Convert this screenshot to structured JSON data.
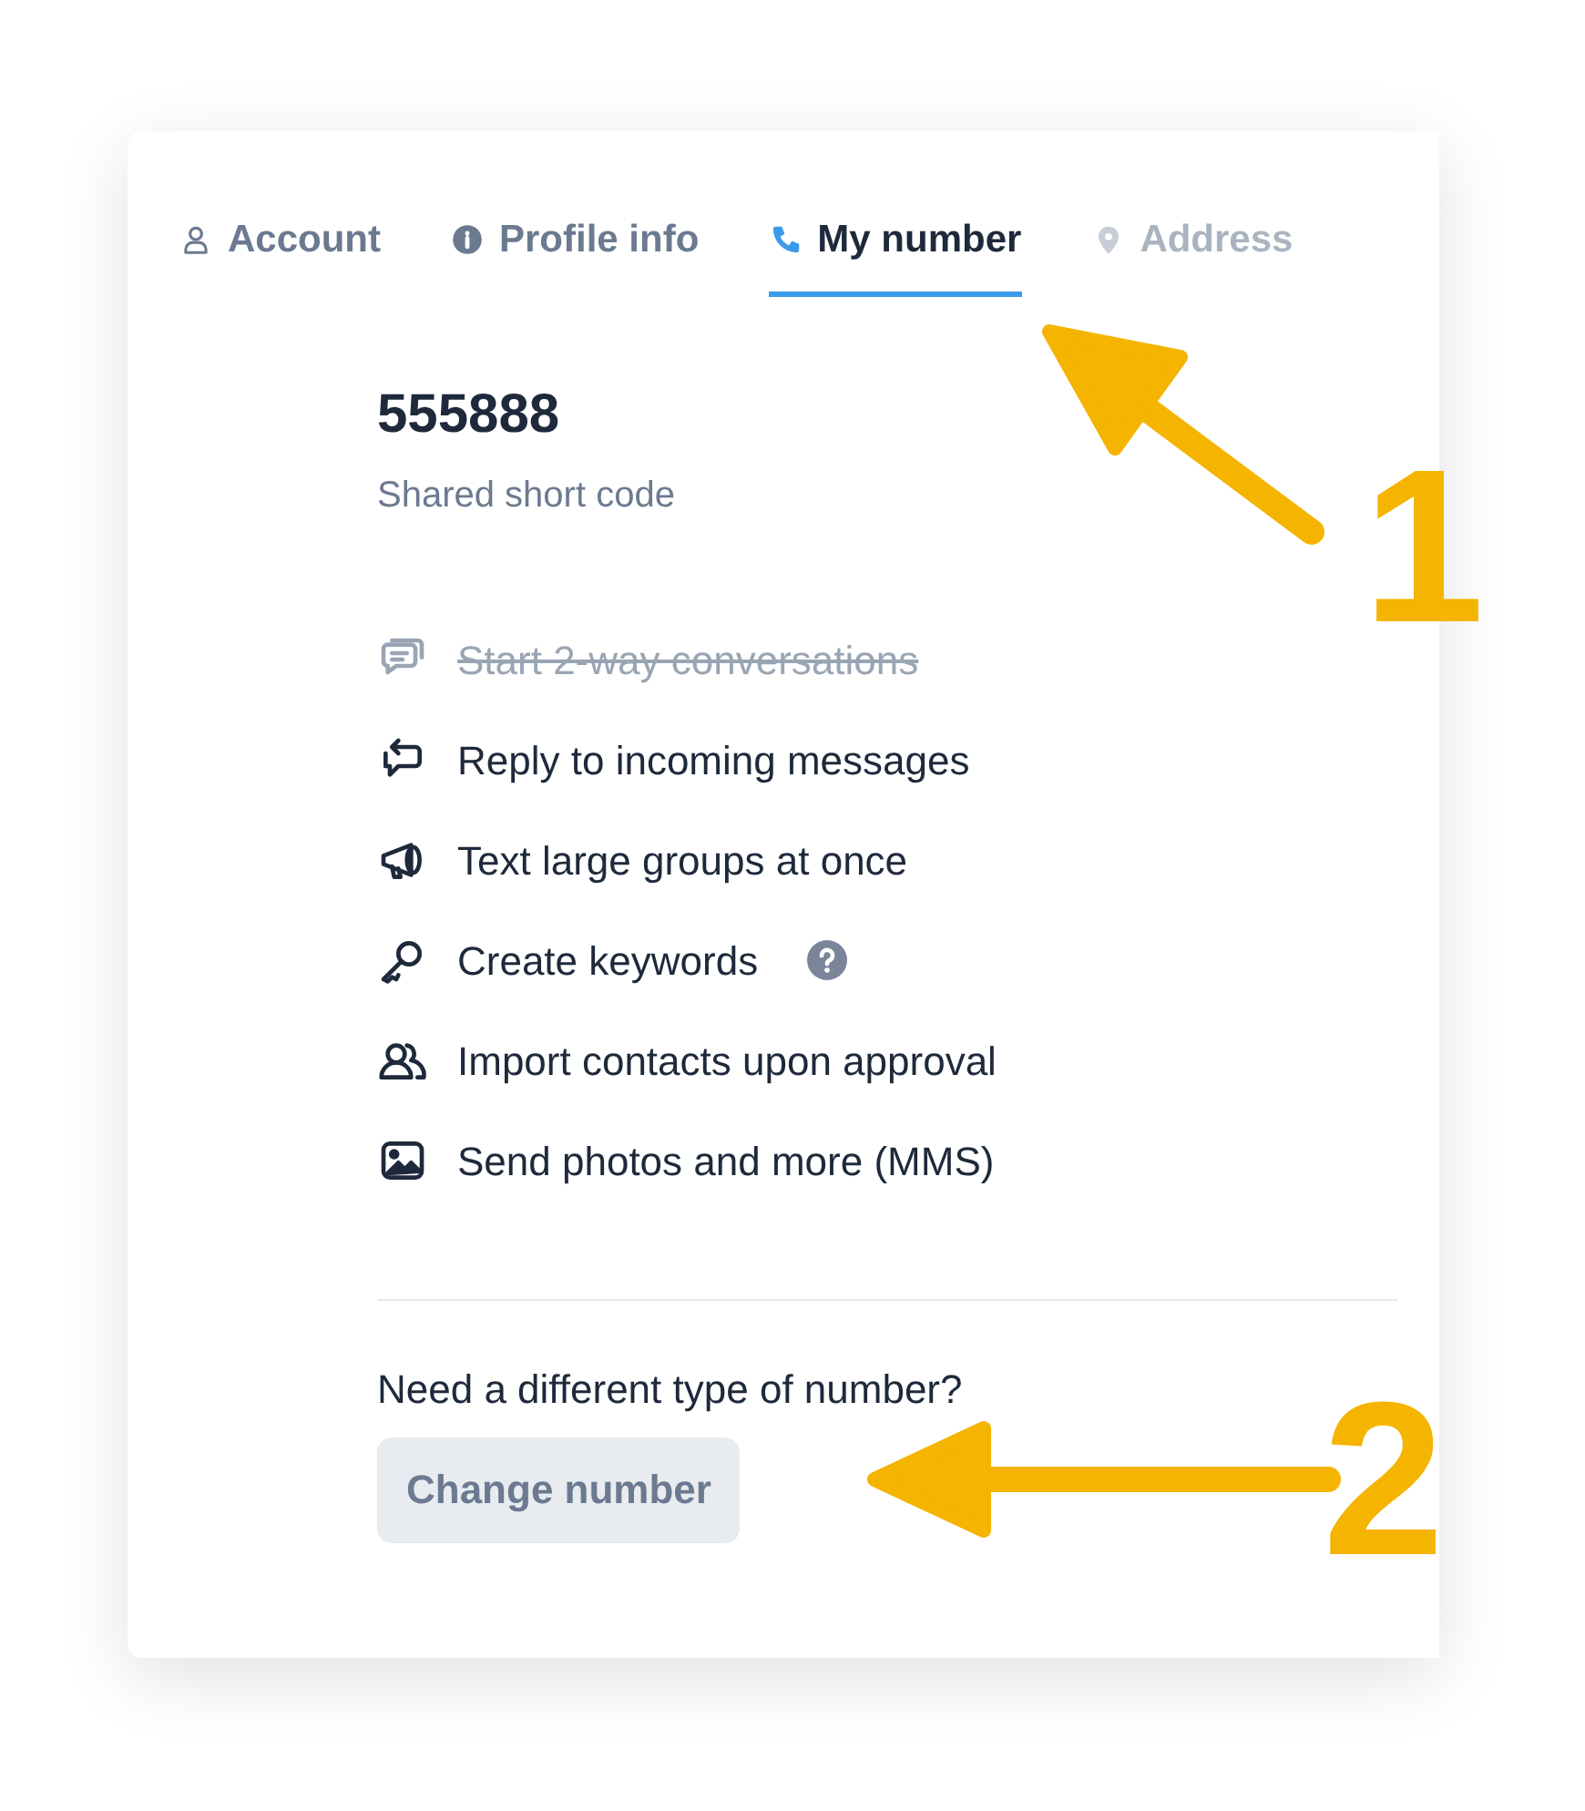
{
  "tabs": [
    {
      "label": "Account",
      "kind": "user",
      "selected": false,
      "faded": false
    },
    {
      "label": "Profile info",
      "kind": "info",
      "selected": false,
      "faded": false
    },
    {
      "label": "My number",
      "kind": "phone",
      "selected": true,
      "faded": false
    },
    {
      "label": "Address",
      "kind": "pin",
      "selected": false,
      "faded": true
    }
  ],
  "number": "555888",
  "number_type": "Shared short code",
  "features": [
    {
      "kind": "chat",
      "label": "Start 2-way conversations",
      "available": false,
      "help": false
    },
    {
      "kind": "reply",
      "label": "Reply to incoming messages",
      "available": true,
      "help": false
    },
    {
      "kind": "megaphone",
      "label": "Text large groups at once",
      "available": true,
      "help": false
    },
    {
      "kind": "key",
      "label": "Create keywords",
      "available": true,
      "help": true
    },
    {
      "kind": "contacts",
      "label": "Import contacts upon approval",
      "available": true,
      "help": false
    },
    {
      "kind": "image",
      "label": "Send photos and more (MMS)",
      "available": true,
      "help": false
    }
  ],
  "question": "Need a different type of number?",
  "button": "Change number",
  "callouts": [
    "1",
    "2"
  ]
}
